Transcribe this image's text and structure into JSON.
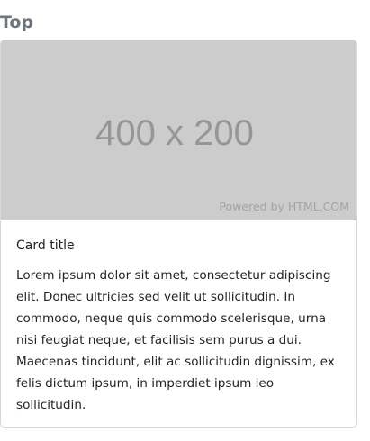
{
  "section": {
    "heading": "Top"
  },
  "card": {
    "image": {
      "dimensions_text": "400 x 200",
      "credit_text": "Powered by HTML.COM",
      "background_color": "#cccccc",
      "text_color": "#969696"
    },
    "title": "Card title",
    "text": "Lorem ipsum dolor sit amet, consectetur adipiscing elit. Donec ultricies sed velit ut sollicitudin. In commodo, neque quis commodo scelerisque, urna nisi feugiat neque, et facilisis sem purus a dui. Maecenas tincidunt, elit ac sollicitudin dignissim, ex felis dictum ipsum, in imperdiet ipsum leo sollicitudin."
  },
  "colors": {
    "heading": "#6c757d",
    "body_text": "#212529",
    "card_border": "#d7d7d7"
  }
}
